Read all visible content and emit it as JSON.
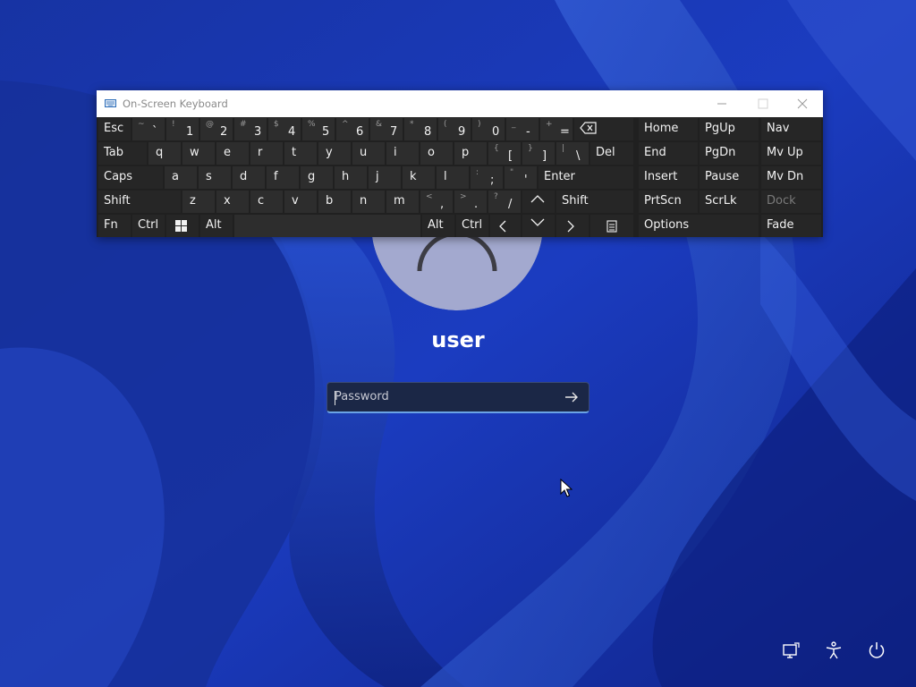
{
  "lock_screen": {
    "username": "user",
    "password_placeholder": "Password",
    "submit_icon": "arrow-right-icon",
    "system_icons": [
      "network-icon",
      "accessibility-icon",
      "power-icon"
    ]
  },
  "osk": {
    "title": "On-Screen Keyboard",
    "title_icon": "keyboard-icon",
    "window_buttons": [
      "minimize-icon",
      "maximize-icon",
      "close-icon"
    ],
    "keys": {
      "esc": "Esc",
      "tab": "Tab",
      "caps": "Caps",
      "shift": "Shift",
      "fn": "Fn",
      "ctrl": "Ctrl",
      "alt": "Alt",
      "del": "Del",
      "enter": "Enter",
      "home": "Home",
      "pgup": "PgUp",
      "nav": "Nav",
      "end": "End",
      "pgdn": "PgDn",
      "mvup": "Mv Up",
      "insert": "Insert",
      "pause": "Pause",
      "mvdn": "Mv Dn",
      "prtscn": "PrtScn",
      "scrlk": "ScrLk",
      "dock": "Dock",
      "options": "Options",
      "fade": "Fade"
    },
    "number_row": [
      {
        "shift": "~",
        "main": "`"
      },
      {
        "shift": "!",
        "main": "1"
      },
      {
        "shift": "@",
        "main": "2"
      },
      {
        "shift": "#",
        "main": "3"
      },
      {
        "shift": "$",
        "main": "4"
      },
      {
        "shift": "%",
        "main": "5"
      },
      {
        "shift": "^",
        "main": "6"
      },
      {
        "shift": "&",
        "main": "7"
      },
      {
        "shift": "*",
        "main": "8"
      },
      {
        "shift": "(",
        "main": "9"
      },
      {
        "shift": ")",
        "main": "0"
      },
      {
        "shift": "_",
        "main": "-"
      },
      {
        "shift": "+",
        "main": "="
      }
    ],
    "row_q": [
      "q",
      "w",
      "e",
      "r",
      "t",
      "y",
      "u",
      "i",
      "o",
      "p"
    ],
    "row_q_symbols": [
      {
        "shift": "{",
        "main": "["
      },
      {
        "shift": "}",
        "main": "]"
      },
      {
        "shift": "|",
        "main": "\\"
      }
    ],
    "row_a": [
      "a",
      "s",
      "d",
      "f",
      "g",
      "h",
      "j",
      "k",
      "l"
    ],
    "row_a_symbols": [
      {
        "shift": ":",
        "main": ";"
      },
      {
        "shift": "\"",
        "main": "'"
      }
    ],
    "row_z": [
      "z",
      "x",
      "c",
      "v",
      "b",
      "n",
      "m"
    ],
    "row_z_symbols": [
      {
        "shift": "<",
        "main": ","
      },
      {
        "shift": ">",
        "main": "."
      },
      {
        "shift": "?",
        "main": "/"
      }
    ]
  }
}
